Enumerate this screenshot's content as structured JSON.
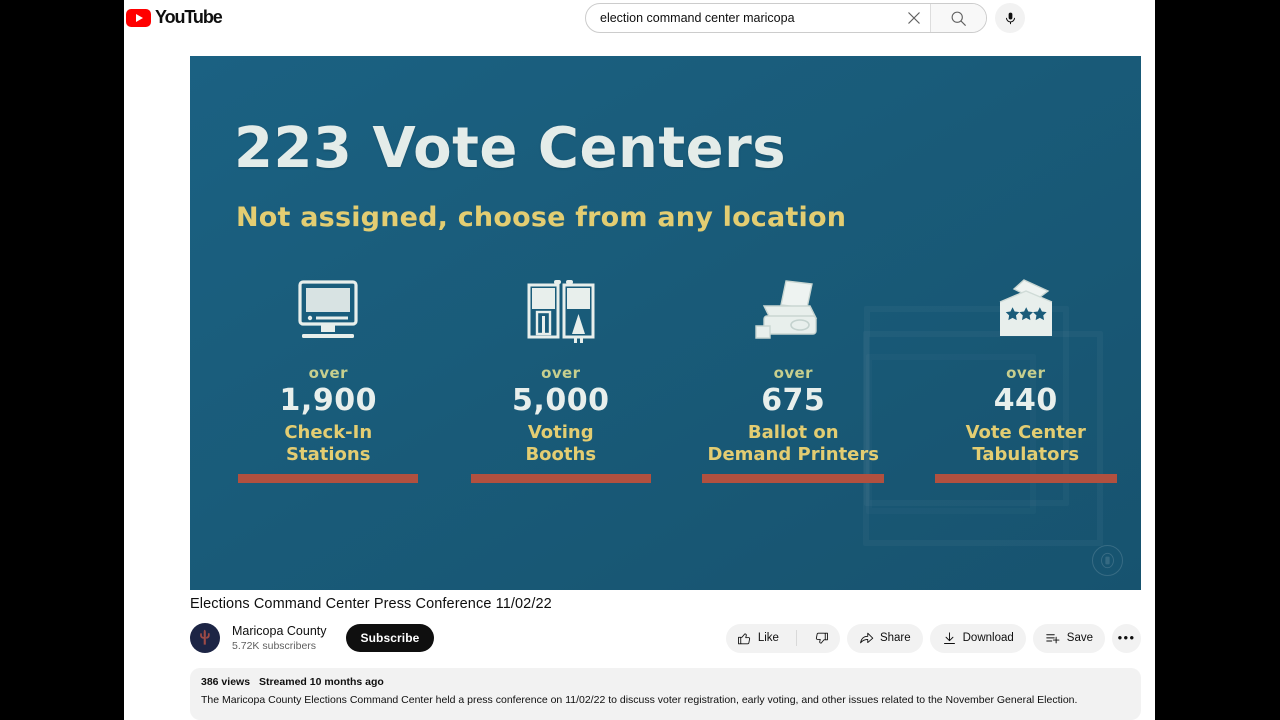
{
  "brand": {
    "name": "YouTube",
    "logo_color": "#ff0000"
  },
  "search": {
    "value": "election command center maricopa",
    "placeholder": "Search",
    "clear_icon": "close-icon",
    "submit_icon": "search-icon",
    "voice_icon": "microphone-icon"
  },
  "player": {
    "headline": "223 Vote Centers",
    "subhead": "Not assigned, choose from any location",
    "background_color": "#1a5c7a",
    "accent_yellow": "#e3cd72",
    "accent_rule": "#b1503f",
    "watermark": "seal-icon",
    "stats": [
      {
        "icon": "monitor-icon",
        "over": "over",
        "number": "1,900",
        "label": "Check-In\nStations"
      },
      {
        "icon": "voting-booth-icon",
        "over": "over",
        "number": "5,000",
        "label": "Voting\nBooths"
      },
      {
        "icon": "printer-icon",
        "over": "over",
        "number": "675",
        "label": "Ballot on\nDemand Printers"
      },
      {
        "icon": "ballot-box-icon",
        "over": "over",
        "number": "440",
        "label": "Vote Center\nTabulators"
      }
    ]
  },
  "video": {
    "title": "Elections Command Center Press Conference 11/02/22",
    "channel": {
      "name": "Maricopa County",
      "subscribers": "5.72K subscribers",
      "avatar_icon": "cactus-avatar",
      "avatar_bg": "#1d2545",
      "avatar_fg": "#9e4a46"
    },
    "subscribe_label": "Subscribe",
    "actions": {
      "like_label": "Like",
      "like_icon": "thumbs-up-icon",
      "dislike_icon": "thumbs-down-icon",
      "share_label": "Share",
      "share_icon": "share-arrow-icon",
      "download_label": "Download",
      "download_icon": "download-icon",
      "save_label": "Save",
      "save_icon": "save-to-playlist-icon",
      "more_label": "•••",
      "more_icon": "more-horizontal-icon"
    }
  },
  "description": {
    "views": "386 views",
    "published": "Streamed 10 months ago",
    "text": "The Maricopa County Elections Command Center held a press conference on 11/02/22 to discuss voter registration, early voting, and other issues related to the November General Election."
  }
}
